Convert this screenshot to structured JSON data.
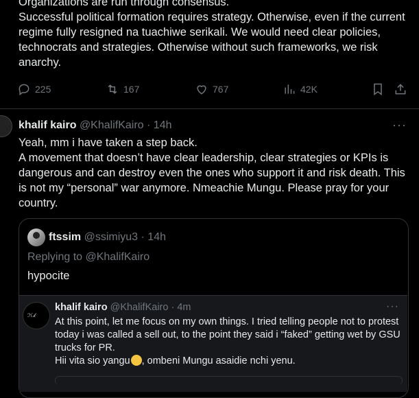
{
  "tweet1": {
    "lines": [
      "Organizations are run through consensus.",
      "Successful political formation requires strategy. Otherwise, even if the current regime fully resigned na tuachiwe serikali. We would need clear policies, technocrats and strategies. Otherwise without such frameworks, we risk anarchy."
    ],
    "actions": {
      "replies": "225",
      "reposts": "167",
      "likes": "767",
      "views": "42K"
    }
  },
  "tweet2": {
    "name": "khalif kairo",
    "handle": "@KhalifKairo",
    "time": "· 14h",
    "more": "···",
    "lines": [
      "Yeah, mm i have taken a step back.",
      "A movement that doesn’t have clear leadership, clear strategies or KPIs is dangerous and can destroy even the ones who support it and risk death. This is not my “personal” war anymore. Nmeachie Mungu. Please pray for your country."
    ]
  },
  "quote": {
    "name": "ftssim",
    "handle": "@ssimiyu3",
    "time": "· 14h",
    "replying_to": "Replying to @KhalifKairo",
    "text": "hypocite"
  },
  "inner_quote": {
    "name": "khalif kairo",
    "handle": "@KhalifKairo",
    "time": "· 4m",
    "more": "···",
    "line1": "At this point, let me focus on my own things. I tried telling people not to protest today i was called a sell out, to the point they said i “faked” getting wet by GSU trucks for PR.",
    "line2_before": "Hii vita sio yangu",
    "line2_after": ", ombeni Mungu asaidie nchi yenu."
  },
  "icons": {
    "reply": "reply-icon",
    "repost": "repost-icon",
    "like": "like-icon",
    "views": "views-icon",
    "bookmark": "bookmark-icon",
    "share": "share-icon"
  }
}
